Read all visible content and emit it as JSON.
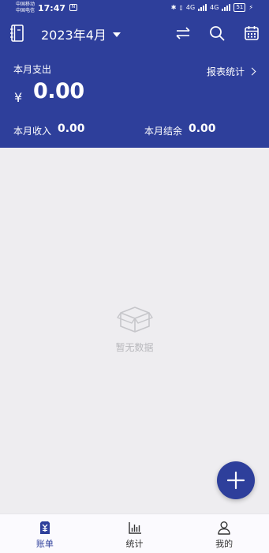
{
  "status_bar": {
    "carrier_1": "中国移动",
    "carrier_2": "中国电信",
    "time": "17:47",
    "nfc": "N",
    "net_1": "4G",
    "net_2": "4G",
    "battery": "51"
  },
  "header": {
    "month": "2023年4月",
    "expense_label": "本月支出",
    "currency_symbol": "¥",
    "expense_amount": "0.00",
    "report_link": "报表统计",
    "income_label": "本月收入",
    "income_amount": "0.00",
    "balance_label": "本月结余",
    "balance_amount": "0.00"
  },
  "empty_state": {
    "text": "暂无数据"
  },
  "tabs": [
    {
      "label": "账单",
      "icon": "bill-icon",
      "active": true
    },
    {
      "label": "统计",
      "icon": "chart-icon",
      "active": false
    },
    {
      "label": "我的",
      "icon": "person-icon",
      "active": false
    }
  ],
  "colors": {
    "primary": "#2e3f9b",
    "background": "#eeedf0",
    "tabbar": "#fbfafe"
  }
}
